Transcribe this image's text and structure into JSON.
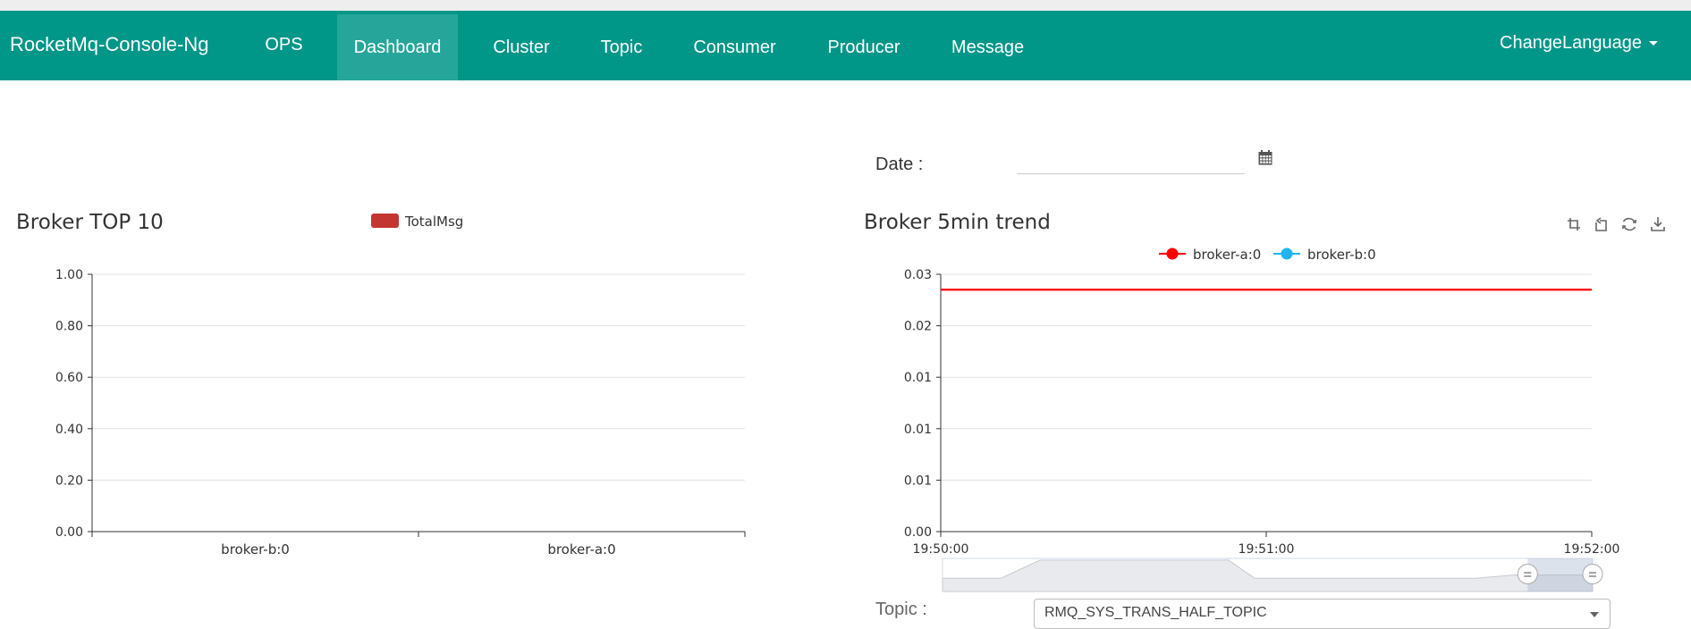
{
  "navbar": {
    "brand": "RocketMq-Console-Ng",
    "ops": "OPS",
    "items": [
      "Dashboard",
      "Cluster",
      "Topic",
      "Consumer",
      "Producer",
      "Message"
    ],
    "active": "Dashboard",
    "language": "ChangeLanguage"
  },
  "filters": {
    "date_label": "Date :",
    "date_value": "",
    "topic_label": "Topic :",
    "topic_value": "RMQ_SYS_TRANS_HALF_TOPIC"
  },
  "chart_data": [
    {
      "type": "bar",
      "title": "Broker TOP 10",
      "legend": [
        "TotalMsg"
      ],
      "legend_position": "top-center",
      "categories": [
        "broker-b:0",
        "broker-a:0"
      ],
      "series": [
        {
          "name": "TotalMsg",
          "values": [
            0,
            0
          ],
          "color": "#c23531"
        }
      ],
      "yticks": [
        "0.00",
        "0.20",
        "0.40",
        "0.60",
        "0.80",
        "1.00"
      ],
      "ylim": [
        0,
        1
      ],
      "grid": true
    },
    {
      "type": "line",
      "title": "Broker 5min trend",
      "legend": [
        "broker-a:0",
        "broker-b:0"
      ],
      "legend_position": "top-center",
      "x": [
        "19:50:00",
        "19:51:00",
        "19:52:00"
      ],
      "yticks": [
        "0.00",
        "0.01",
        "0.01",
        "0.01",
        "0.02",
        "0.03"
      ],
      "ylim": [
        0,
        0.025
      ],
      "series": [
        {
          "name": "broker-a:0",
          "color": "#ff0000",
          "x": [
            "19:50:00",
            "19:52:00"
          ],
          "values": [
            0.0235,
            0.0235
          ]
        },
        {
          "name": "broker-b:0",
          "color": "#1fb5f5",
          "x": [],
          "values": []
        }
      ],
      "grid": true,
      "toolbox": [
        "zoom-icon",
        "zoom-reset-icon",
        "restore-icon",
        "download-icon"
      ],
      "datazoom_range": [
        90,
        100
      ]
    }
  ]
}
